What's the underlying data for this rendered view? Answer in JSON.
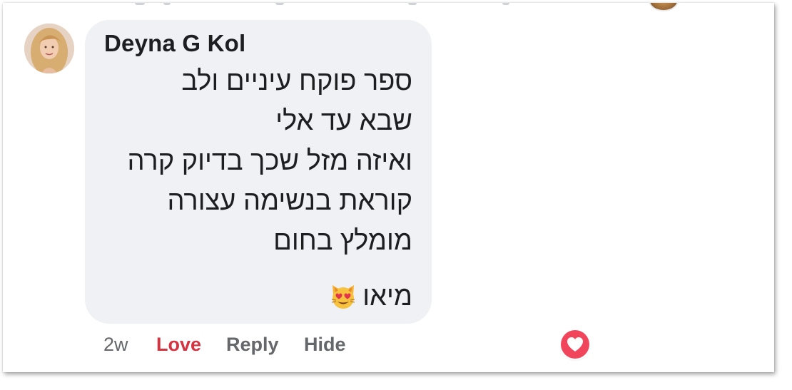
{
  "comment": {
    "author": "Deyna G Kol",
    "message_lines": [
      "ספר פוקח עיניים ולב",
      "שבא עד אלי",
      "ואיזה מזל שכך בדיוק קרה",
      "קוראת בנשימה עצורה",
      "מומלץ בחום"
    ],
    "signoff": "מיאו",
    "signoff_emoji": "heart-eyes-cat-emoji",
    "timestamp": "2w",
    "actions": {
      "love": "Love",
      "reply": "Reply",
      "hide": "Hide"
    },
    "reaction_icon": "love-reaction-icon"
  },
  "colors": {
    "bubble": "#f0f1f4",
    "love_active": "#d6323f",
    "reaction_bg": "#f1455c",
    "meta_text": "#65676b"
  }
}
